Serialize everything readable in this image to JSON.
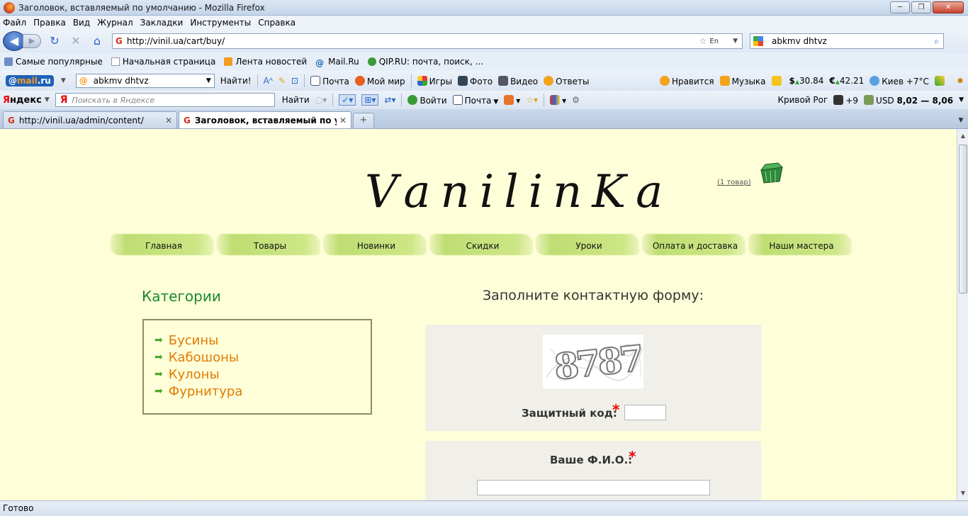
{
  "window": {
    "title": "Заголовок, вставляемый по умолчанию - Mozilla Firefox"
  },
  "menu": [
    "Файл",
    "Правка",
    "Вид",
    "Журнал",
    "Закладки",
    "Инструменты",
    "Справка"
  ],
  "nav": {
    "url": "http://vinil.ua/cart/buy/",
    "search_value": "abkmv dhtvz",
    "lang": "En"
  },
  "bookmarks": [
    "Самые популярные",
    "Начальная страница",
    "Лента новостей",
    "Mail.Ru",
    "QIP.RU: почта, поиск, ..."
  ],
  "mailru_bar": {
    "search_value": "abkmv dhtvz",
    "find": "Найти!",
    "items": [
      "Почта",
      "Мой мир",
      "Игры",
      "Фото",
      "Видео",
      "Ответы"
    ],
    "right": {
      "like": "Нравится",
      "music": "Музыка",
      "usd": "30.84",
      "eur": "42.21",
      "weather": "Киев +7°C"
    }
  },
  "yandex_bar": {
    "label": "Яндекс",
    "placeholder": "Поискать в Яндексе",
    "find": "Найти",
    "login": "Войти",
    "mail": "Почта",
    "city": "Кривой Рог",
    "temp": "+9",
    "usd_label": "USD",
    "usd_values": "8,02 — 8,06"
  },
  "tabs": [
    {
      "label": "http://vinil.ua/admin/content/",
      "active": false
    },
    {
      "label": "Заголовок, вставляемый по умо...",
      "active": true
    }
  ],
  "status": "Готово",
  "site": {
    "logo": "VanilinKa",
    "cart_link": "(1 товар)",
    "nav": [
      "Главная",
      "Товары",
      "Новинки",
      "Скидки",
      "Уроки",
      "Оплата и доставка",
      "Наши мастера"
    ],
    "categories_title": "Категории",
    "categories": [
      "Бусины",
      "Кабошоны",
      "Кулоны",
      "Фурнитура"
    ],
    "form_title": "Заполните контактную форму:",
    "captcha_value": "8787",
    "captcha_label": "Защитный код:",
    "name_label": "Ваше Ф.И.О.:"
  },
  "colors": {
    "page_bg": "#fefed9",
    "category_link": "#e07b00",
    "category_title": "#1a8a2e",
    "required": "#e00000"
  }
}
